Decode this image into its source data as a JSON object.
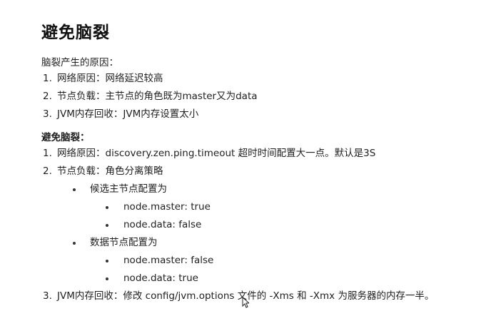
{
  "title": "避免脑裂",
  "causes": {
    "heading": "脑裂产生的原因：",
    "items": [
      {
        "num": "1.",
        "text": "网络原因：网络延迟较高"
      },
      {
        "num": "2.",
        "text": "节点负载：主节点的角色既为master又为data"
      },
      {
        "num": "3.",
        "text": "JVM内存回收：JVM内存设置太小"
      }
    ]
  },
  "avoid": {
    "heading": "避免脑裂：",
    "items": [
      {
        "num": "1.",
        "text": "网络原因：discovery.zen.ping.timeout 超时时间配置大一点。默认是3S"
      },
      {
        "num": "2.",
        "text": "节点负载：角色分离策略"
      },
      {
        "num": "3.",
        "text": "JVM内存回收：修改 config/jvm.options 文件的 -Xms 和 -Xmx 为服务器的内存一半。"
      }
    ],
    "roles": [
      {
        "label": "候选主节点配置为",
        "settings": [
          "node.master: true",
          "node.data: false"
        ]
      },
      {
        "label": "数据节点配置为",
        "settings": [
          "node.master: false",
          "node.data: true"
        ]
      }
    ]
  }
}
